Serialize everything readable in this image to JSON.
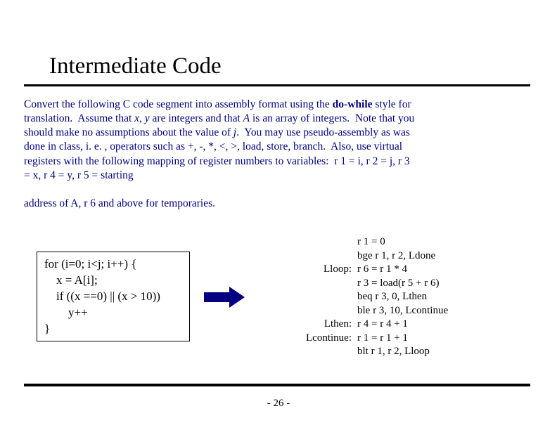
{
  "title": "Intermediate Code",
  "paragraph_html": "Convert the following C code segment into assembly format using the <b>do-while</b> style for translation.&nbsp; Assume that <i>x, y</i> are integers and that <i>A</i> is an array of integers.&nbsp; Note that you should make no assumptions about the value of <i>j</i>.&nbsp; You may use pseudo-assembly as was done in class, i. e. , operators such as +, -, *, &lt;, &gt;, load, store, branch.&nbsp; Also, use virtual registers with the following mapping of register numbers to variables:&nbsp; r 1 = i, r 2 = j, r 3 = x, r 4 = y, r 5 = starting<br><br>address of A, r 6 and above for temporaries.",
  "c_code": "for (i=0; i<j; i++) {\n    x = A[i];\n    if ((x ==0) || (x > 10))\n        y++\n}",
  "asm_lines": [
    {
      "label": "",
      "instr": "r 1 = 0"
    },
    {
      "label": "",
      "instr": "bge r 1, r 2, Ldone"
    },
    {
      "label": "Lloop:",
      "instr": "r 6 = r 1 * 4"
    },
    {
      "label": "",
      "instr": "r 3 = load(r 5 + r 6)"
    },
    {
      "label": "",
      "instr": "beq r 3, 0, Lthen"
    },
    {
      "label": "",
      "instr": "ble r 3, 10, Lcontinue"
    },
    {
      "label": "Lthen:",
      "instr": "r 4 = r 4 + 1"
    },
    {
      "label": "Lcontinue:",
      "instr": "r 1 = r 1 + 1"
    },
    {
      "label": "",
      "instr": "blt r 1, r 2, Lloop"
    }
  ],
  "page_number": "- 26 -"
}
